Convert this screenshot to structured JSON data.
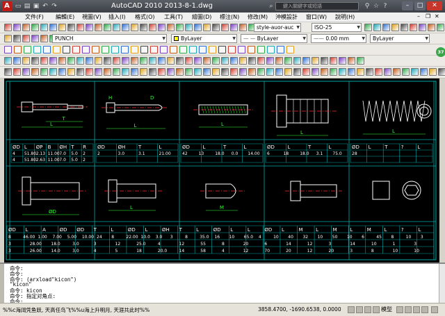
{
  "title_bar": {
    "app_logo": "A",
    "title": "AutoCAD 2010    2013-8-1.dwg",
    "search_placeholder": "鍵入關鍵字或短語"
  },
  "menu": [
    "文件(F)",
    "編輯(E)",
    "視圖(V)",
    "插入(I)",
    "格式(O)",
    "工具(T)",
    "繪圖(D)",
    "標注(N)",
    "修改(M)",
    "沖模設計",
    "窗口(W)",
    "說明(H)"
  ],
  "toolbars": {
    "text_style": "style-auor-auc",
    "dim_style": "ISO-25",
    "workspace": "PUNCH",
    "layer": "ByLayer",
    "linetype": "ByLayer",
    "lineweight": "0.00 mm",
    "plotstyle": "ByLayer",
    "badge": "37"
  },
  "drawing": {
    "row1_titles": [
      "",
      "",
      "",
      "",
      ""
    ],
    "row1_headers": [
      [
        "ØD",
        "L",
        "ØP",
        "B",
        "ØH",
        "T",
        "R"
      ],
      [
        "ØD",
        "ØH",
        "T",
        "L"
      ],
      [
        "ØD",
        "L",
        "T",
        "L"
      ],
      [
        "ØD",
        "L",
        "T",
        "L"
      ],
      [
        "ØD",
        "L",
        "T",
        "?",
        "L"
      ]
    ],
    "row1_values": [
      [
        "4",
        "51.80",
        "2.13",
        "11.00",
        "7.0",
        "5.0",
        "2"
      ],
      [
        "4",
        "51.80",
        "2.63",
        "11.00",
        "7.0",
        "5.0",
        "2"
      ]
    ],
    "row1_values_b": [
      [
        "2",
        "3.0",
        "3.1",
        "21.00"
      ]
    ],
    "row1_values_c": [
      [
        "42",
        "13",
        "18.0",
        "0.0",
        "14.00"
      ]
    ],
    "row1_values_d": [
      [
        "6",
        "18",
        "18.0",
        "3.1",
        "75.0"
      ]
    ],
    "row1_values_e": [
      [
        "28"
      ]
    ],
    "row2_headers": [
      "ØD",
      "L",
      "A",
      "ØD",
      "ØD",
      "T",
      "L",
      "ØD",
      "L",
      "ØH",
      "T",
      "L",
      "ØD",
      "L",
      "L",
      "ØD",
      "L",
      "M",
      "L",
      "M",
      "L",
      "M",
      "L",
      "?",
      "L"
    ],
    "row2_values": [
      [
        "8",
        "46.00",
        "1.00",
        "7.00",
        "5.00",
        "10.00",
        "24",
        "8",
        "22.00",
        "10.0",
        "3.0",
        "3",
        "8",
        "35.0",
        "16",
        "10",
        "65.0",
        "4",
        "10",
        "40",
        "32",
        "10",
        "50",
        "10",
        "6",
        "45",
        "8",
        "10",
        "3"
      ],
      [
        "3",
        "28.00",
        "18.0",
        "3.0",
        "3",
        "12",
        "25.0",
        "4",
        "12",
        "55",
        "8",
        "20",
        "6",
        "14",
        "12",
        "3",
        "14",
        "10",
        "1",
        "3"
      ],
      [
        "3",
        "26.00",
        "14.0",
        "3.0",
        "4",
        "5",
        "18",
        "20.0",
        "14",
        "58",
        "4",
        "12",
        "70",
        "20",
        "12",
        "20",
        "3",
        "8",
        "10",
        "10"
      ]
    ],
    "dims": [
      "L",
      "H",
      "B",
      "P",
      "T",
      "D",
      "L",
      "H",
      "D",
      "A",
      "L",
      "L",
      "ØD",
      "L",
      "E",
      "L",
      "M",
      "L"
    ]
  },
  "command": {
    "lines": [
      "命令:",
      "命令:",
      "命令: (arxload\"kicon\")",
      "\"kicon\"",
      "命令: kicon",
      "命令: 指定对角点:",
      "命令:"
    ]
  },
  "status": {
    "text": "%%c海阔凭鱼跃, 天高任鸟飞%%u海上升明月, 天涯共此时%%",
    "coords": "3858.4700, -1690.6538, 0.0000",
    "model": "模型"
  },
  "colors": {
    "grid_line": "#00aaaa",
    "part": "#ffffff",
    "centerline": "#ff3030",
    "dimension": "#30ff30",
    "table_text": "#ffffff"
  }
}
